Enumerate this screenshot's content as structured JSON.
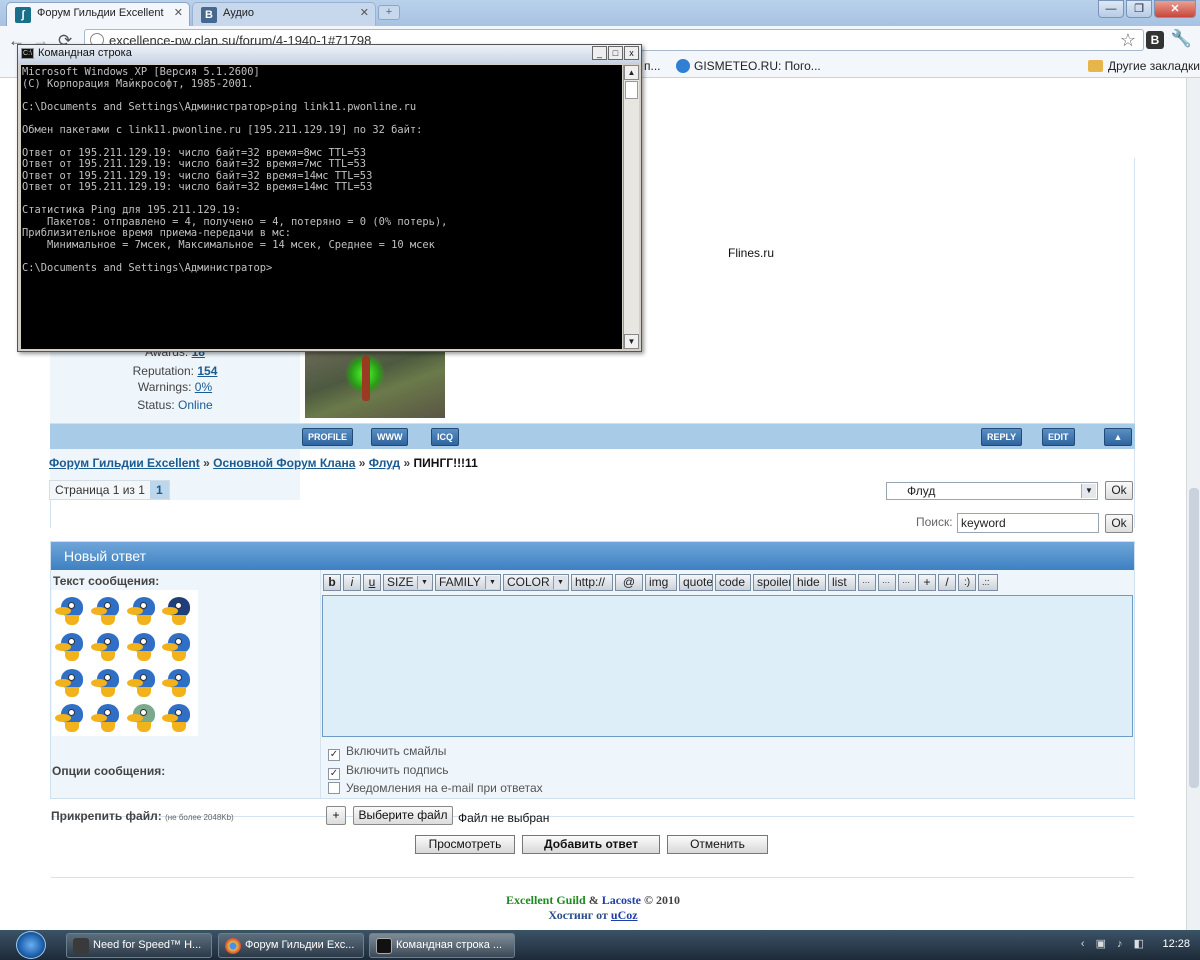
{
  "browser": {
    "tabs": [
      {
        "label": "Форум Гильдии Excellent",
        "close": "✕"
      },
      {
        "label": "Аудио",
        "close": "✕"
      }
    ],
    "new_tab": "+",
    "window_controls": {
      "minimize": "—",
      "maximize": "❐",
      "close": "✕"
    },
    "nav": {
      "back": "←",
      "forward": "→",
      "reload": "⟳"
    },
    "url": "excellence-pw.clan.su/forum/4-1940-1#71798",
    "star": "☆",
    "vk": "B",
    "wrench": "🔧",
    "bookmarks": [
      {
        "label": "п..."
      },
      {
        "label": "GISMETEO.RU: Пого..."
      }
    ],
    "other_bookmarks": "Другие закладки"
  },
  "cmd": {
    "title": "Командная строка",
    "icon": "C:\\",
    "controls": {
      "minimize": "_",
      "maximize": "□",
      "close": "x"
    },
    "lines": [
      "Microsoft Windows XP [Версия 5.1.2600]",
      "(С) Корпорация Майкрософт, 1985-2001.",
      "",
      "C:\\Documents and Settings\\Администратор>ping link11.pwonline.ru",
      "",
      "Обмен пакетами с link11.pwonline.ru [195.211.129.19] по 32 байт:",
      "",
      "Ответ от 195.211.129.19: число байт=32 время=8мс TTL=53",
      "Ответ от 195.211.129.19: число байт=32 время=7мс TTL=53",
      "Ответ от 195.211.129.19: число байт=32 время=14мс TTL=53",
      "Ответ от 195.211.129.19: число байт=32 время=14мс TTL=53",
      "",
      "Статистика Ping для 195.211.129.19:",
      "    Пакетов: отправлено = 4, получено = 4, потеряно = 0 (0% потерь),",
      "Приблизительное время приема-передачи в мс:",
      "    Минимальное = 7мсек, Максимальное = 14 мсек, Среднее = 10 мсек",
      "",
      "C:\\Documents and Settings\\Администратор>"
    ],
    "scroll_up": "▲",
    "scroll_down": "▼"
  },
  "post": {
    "awards_label": "Awards:",
    "awards_value": "18",
    "reputation_label": "Reputation:",
    "reputation_value": "154",
    "warnings_label": "Warnings:",
    "warnings_value": "0%",
    "status_label": "Status:",
    "status_value": "Online",
    "signature": "Flines.ru",
    "buttons": {
      "profile": "PROFILE",
      "www": "WWW",
      "icq": "ICQ",
      "reply": "REPLY",
      "edit": "EDIT",
      "up": "▲"
    }
  },
  "breadcrumb": {
    "items": [
      "Форум Гильдии Excellent",
      "Основной Форум Клана",
      "Флуд"
    ],
    "separator": "»",
    "current": "ПИНГГ!!!11"
  },
  "pager": {
    "label": "Страница 1 из 1",
    "page": "1"
  },
  "jump": {
    "selected": "Флуд",
    "ok": "Ok"
  },
  "search": {
    "label": "Поиск:",
    "value": "keyword",
    "ok": "Ok"
  },
  "reply_form": {
    "header": "Новый ответ",
    "message_label": "Текст сообщения:",
    "bbcodes": [
      "b",
      "i",
      "u",
      "SIZE",
      "FAMILY",
      "COLOR",
      "http://",
      "@",
      "img",
      "quote",
      "code",
      "spoiler",
      "hide",
      "list",
      "···",
      "···",
      "···",
      "+",
      "/",
      ":)",
      ".::"
    ],
    "options_label": "Опции сообщения:",
    "options": [
      {
        "label": "Включить смайлы",
        "checked": true
      },
      {
        "label": "Включить подпись",
        "checked": true
      },
      {
        "label": "Уведомления на e-mail при ответах",
        "checked": false
      }
    ],
    "attach_label": "Прикрепить файл:",
    "attach_note": "(не более 2048Kb)",
    "add_button": "+",
    "choose_file": "Выберите файл",
    "file_status": "Файл не выбран",
    "preview": "Просмотреть",
    "submit": "Добавить ответ",
    "cancel": "Отменить"
  },
  "footer": {
    "guild": "Excellent Guild",
    "amp": "&",
    "lacoste": "Lacoste",
    "year": "© 2010",
    "hosting": "Хостинг от",
    "ucoz": "uCoz"
  },
  "taskbar": {
    "tasks": [
      "Need for Speed™ H...",
      "Форум Гильдии Exc...",
      "Командная строка ..."
    ],
    "tray_icons": "‹ ▣ ♪ ◧",
    "clock": "12:28"
  }
}
